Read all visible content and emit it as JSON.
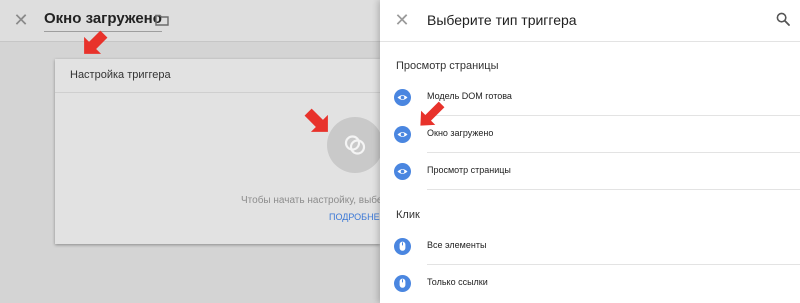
{
  "editor": {
    "title": "Окно загружено",
    "card": {
      "title": "Настройка триггера",
      "hint": "Чтобы начать настройку, выберите тип триггера…",
      "more_link": "ПОДРОБНЕЕ"
    }
  },
  "panel": {
    "title": "Выберите тип триггера",
    "sections": [
      {
        "title": "Просмотр страницы",
        "items": [
          {
            "label": "Модель DOM готова",
            "icon": "eye-icon"
          },
          {
            "label": "Окно загружено",
            "icon": "eye-icon"
          },
          {
            "label": "Просмотр страницы",
            "icon": "eye-icon"
          }
        ]
      },
      {
        "title": "Клик",
        "items": [
          {
            "label": "Все элементы",
            "icon": "mouse-icon"
          },
          {
            "label": "Только ссылки",
            "icon": "mouse-icon"
          }
        ]
      }
    ]
  },
  "colors": {
    "accent_blue": "#4a86e0",
    "annotation_red": "#e8322b",
    "link_blue": "#3b78d6"
  }
}
